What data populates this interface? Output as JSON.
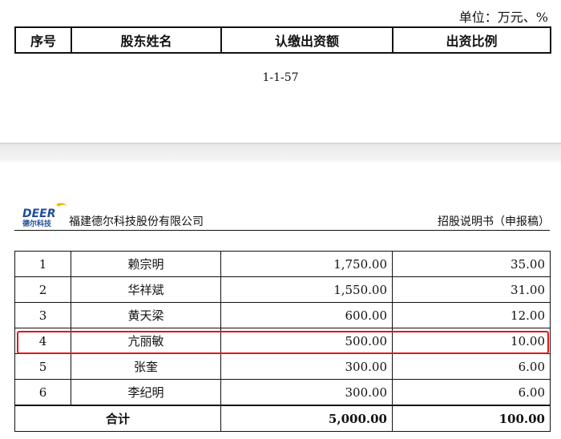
{
  "unit_note": "单位：万元、%",
  "top_table": {
    "headers": [
      "序号",
      "股东姓名",
      "认缴出资额",
      "出资比例"
    ]
  },
  "page_number": "1-1-57",
  "header": {
    "logo_text_top": "DEER",
    "logo_text_bottom": "德尔科技",
    "company": "福建德尔科技股份有限公司",
    "doc_title": "招股说明书（申报稿）"
  },
  "colors": {
    "highlight": "#e0161b",
    "logo_blue": "#1f4e9b",
    "logo_yellow": "#f2b400"
  },
  "shareholders": [
    {
      "no": "1",
      "name": "赖宗明",
      "amount": "1,750.00",
      "ratio": "35.00"
    },
    {
      "no": "2",
      "name": "华祥斌",
      "amount": "1,550.00",
      "ratio": "31.00"
    },
    {
      "no": "3",
      "name": "黄天梁",
      "amount": "600.00",
      "ratio": "12.00"
    },
    {
      "no": "4",
      "name": "亢丽敏",
      "amount": "500.00",
      "ratio": "10.00"
    },
    {
      "no": "5",
      "name": "张奎",
      "amount": "300.00",
      "ratio": "6.00"
    },
    {
      "no": "6",
      "name": "李纪明",
      "amount": "300.00",
      "ratio": "6.00"
    }
  ],
  "total": {
    "label": "合计",
    "amount": "5,000.00",
    "ratio": "100.00"
  }
}
